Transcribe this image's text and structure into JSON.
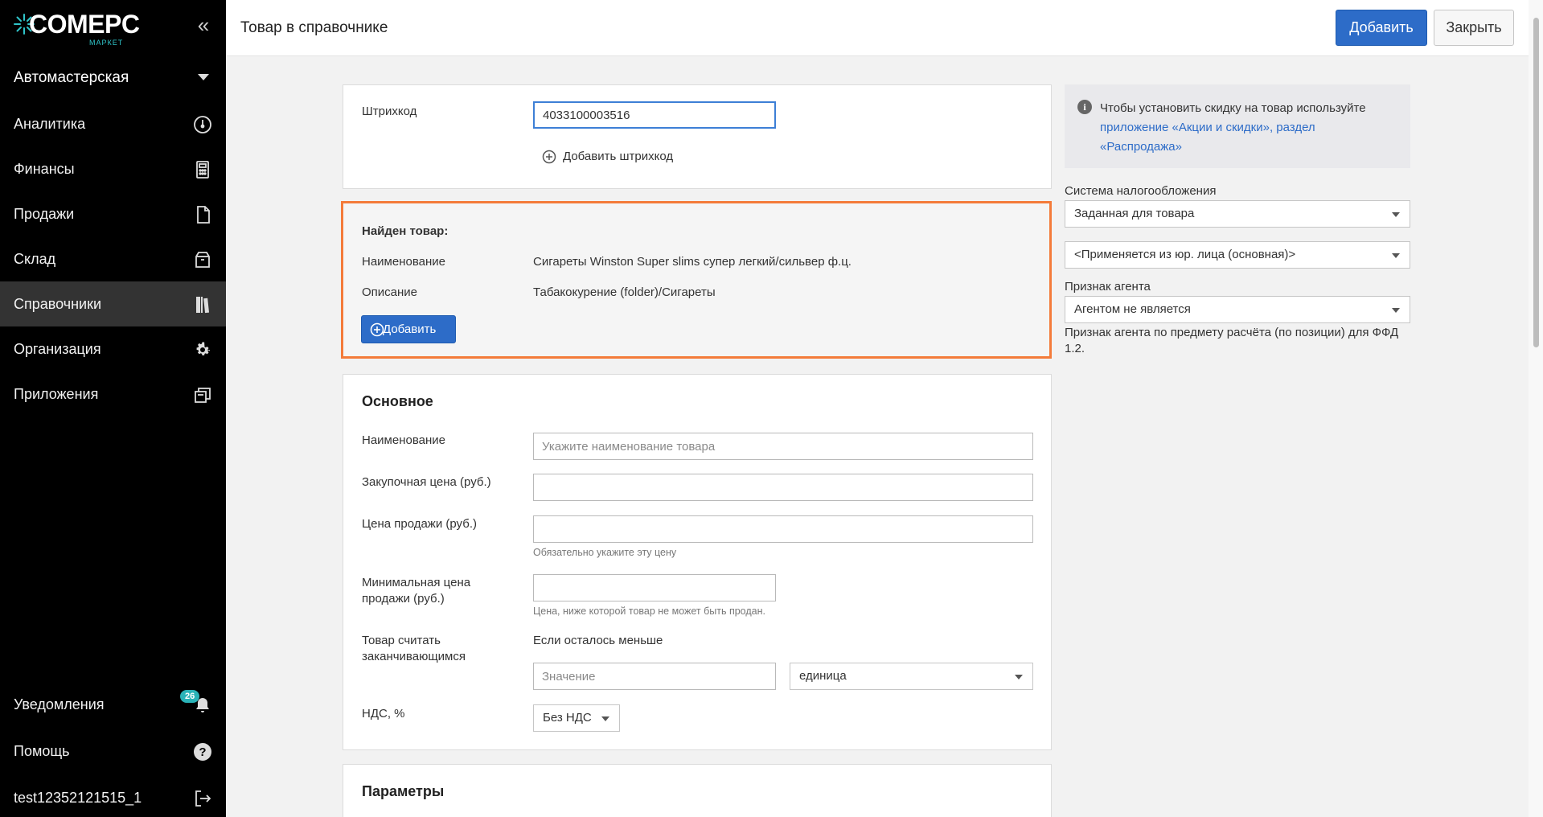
{
  "sidebar": {
    "logo_text": "COMEPC",
    "logo_sub": "МАРКЕТ",
    "organization": "Автомастерская",
    "items": [
      {
        "label": "Аналитика",
        "icon": "gauge-icon"
      },
      {
        "label": "Финансы",
        "icon": "calculator-icon"
      },
      {
        "label": "Продажи",
        "icon": "document-icon"
      },
      {
        "label": "Склад",
        "icon": "box-icon"
      },
      {
        "label": "Справочники",
        "icon": "book-icon"
      },
      {
        "label": "Организация",
        "icon": "gear-icon"
      },
      {
        "label": "Приложения",
        "icon": "windows-icon"
      }
    ],
    "notifications_label": "Уведомления",
    "notifications_count": "26",
    "help_label": "Помощь",
    "user_label": "test12352121515_1"
  },
  "header": {
    "title": "Товар в справочнике",
    "add_label": "Добавить",
    "close_label": "Закрыть"
  },
  "barcode": {
    "label": "Штрихкод",
    "value": "4033100003516",
    "add_label": "Добавить штрихкод"
  },
  "found": {
    "title": "Найден товар:",
    "name_label": "Наименование",
    "name_value": "Сигареты Winston Super slims супер легкий/сильвер ф.ц.",
    "desc_label": "Описание",
    "desc_value": "Табакокурение (folder)/Сигареты",
    "add_label": "Добавить"
  },
  "main": {
    "title": "Основное",
    "name_label": "Наименование",
    "name_placeholder": "Укажите наименование товара",
    "purchase_label": "Закупочная цена (руб.)",
    "sale_label": "Цена продажи (руб.)",
    "sale_hint": "Обязательно укажите эту цену",
    "min_label_1": "Минимальная цена",
    "min_label_2": "продажи (руб.)",
    "min_hint": "Цена, ниже которой товар не может быть продан.",
    "ending_label_1": "Товар считать",
    "ending_label_2": "заканчивающимся",
    "ending_text": "Если осталось меньше",
    "ending_placeholder": "Значение",
    "unit_value": "единица",
    "vat_label": "НДС, %",
    "vat_value": "Без НДС"
  },
  "params": {
    "title": "Параметры"
  },
  "right": {
    "info_text": "Чтобы установить скидку на товар используйте",
    "info_link": "приложение «Акции и скидки», раздел «Распродажа»",
    "tax_label": "Система налогообложения",
    "tax_value": "Заданная для товара",
    "entity_value": "<Применяется из юр. лица (основная)>",
    "agent_label": "Признак агента",
    "agent_value": "Агентом не является",
    "agent_hint": "Признак агента по предмету расчёта (по позиции) для ФФД 1.2."
  }
}
